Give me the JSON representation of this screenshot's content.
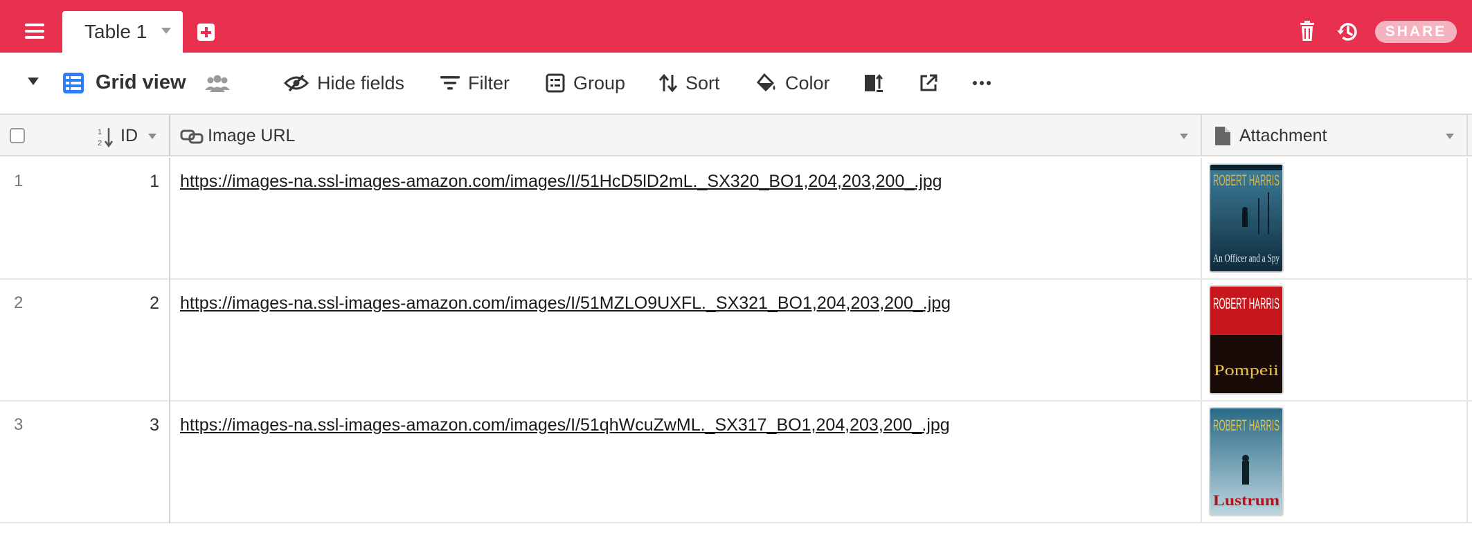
{
  "topbar": {
    "accent": "#e8304f",
    "menu_icon": "hamburger-menu-icon",
    "tab_label": "Table 1",
    "add_tab_icon": "add-table-icon",
    "trash_icon": "trash-icon",
    "history_icon": "history-icon",
    "share_label": "SHARE"
  },
  "viewbar": {
    "view_name": "Grid view",
    "view_icon": "grid-view-icon",
    "collaborators_icon": "collaborators-icon",
    "tools": [
      {
        "label": "Hide fields",
        "icon": "hide-fields-icon"
      },
      {
        "label": "Filter",
        "icon": "filter-icon"
      },
      {
        "label": "Group",
        "icon": "group-icon"
      },
      {
        "label": "Sort",
        "icon": "sort-icon"
      },
      {
        "label": "Color",
        "icon": "color-bucket-icon"
      },
      {
        "label": "",
        "icon": "row-height-icon"
      },
      {
        "label": "",
        "icon": "share-view-icon"
      },
      {
        "label": "",
        "icon": "more-options-icon"
      }
    ]
  },
  "grid": {
    "columns": [
      {
        "name": "ID",
        "type": "autonumber",
        "icon": "autonumber-icon"
      },
      {
        "name": "Image URL",
        "type": "url",
        "icon": "link-icon"
      },
      {
        "name": "Attachment",
        "type": "attachment",
        "icon": "document-icon"
      }
    ],
    "rows": [
      {
        "row_number": "1",
        "id": "1",
        "image_url": "https://images-na.ssl-images-amazon.com/images/I/51HcD5lD2mL._SX320_BO1,204,203,200_.jpg",
        "attachment": {
          "author": "ROBERT HARRIS",
          "title": "An Officer and a Spy",
          "palette": [
            "#1d4a63",
            "#d8b54a"
          ]
        }
      },
      {
        "row_number": "2",
        "id": "2",
        "image_url": "https://images-na.ssl-images-amazon.com/images/I/51MZLO9UXFL._SX321_BO1,204,203,200_.jpg",
        "attachment": {
          "author": "ROBERT HARRIS",
          "title": "Pompeii",
          "palette": [
            "#c8161d",
            "#e8c24a"
          ]
        }
      },
      {
        "row_number": "3",
        "id": "3",
        "image_url": "https://images-na.ssl-images-amazon.com/images/I/51qhWcuZwML._SX317_BO1,204,203,200_.jpg",
        "attachment": {
          "author": "ROBERT HARRIS",
          "title": "Lustrum",
          "palette": [
            "#1f5a74",
            "#b3141b"
          ]
        }
      }
    ]
  }
}
